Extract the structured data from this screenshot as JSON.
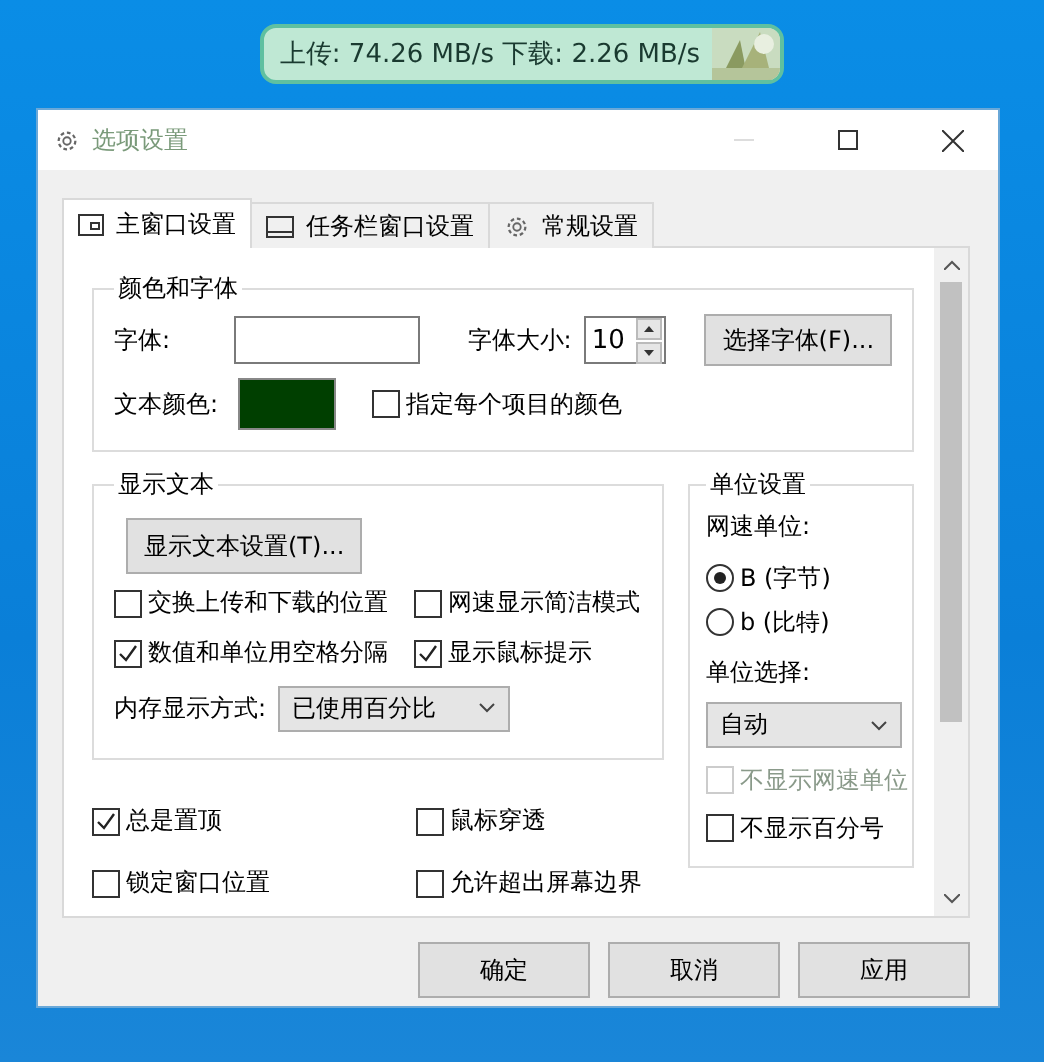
{
  "speed_widget": {
    "text": "上传: 74.26 MB/s 下载: 2.26 MB/s"
  },
  "window": {
    "title": "选项设置"
  },
  "tabs": [
    {
      "label": "主窗口设置",
      "kind": "window",
      "selected": true
    },
    {
      "label": "任务栏窗口设置",
      "kind": "taskbar",
      "selected": false
    },
    {
      "label": "常规设置",
      "kind": "gear",
      "selected": false
    }
  ],
  "color_font": {
    "title": "颜色和字体",
    "font_label": "字体:",
    "font_size_label": "字体大小:",
    "font_size": "10",
    "choose_font_button": "选择字体(F)...",
    "text_color_label": "文本颜色:",
    "text_color_swatch": {
      "color": "#003f00"
    },
    "per_item_color": {
      "label": "指定每个项目的颜色",
      "checked": false
    }
  },
  "display_text": {
    "title": "显示文本",
    "settings_button": "显示文本设置(T)...",
    "checkboxes": [
      {
        "label": "交换上传和下载的位置",
        "checked": false
      },
      {
        "label": "网速显示简洁模式",
        "checked": false
      },
      {
        "label": "数值和单位用空格分隔",
        "checked": true
      },
      {
        "label": "显示鼠标提示",
        "checked": true
      }
    ],
    "memory_label": "内存显示方式:",
    "memory_value": "已使用百分比"
  },
  "unit_settings": {
    "title": "单位设置",
    "speed_unit_label": "网速单位:",
    "radios": [
      {
        "label": "B (字节)",
        "selected": true
      },
      {
        "label": "b (比特)",
        "selected": false
      }
    ],
    "unit_select_label": "单位选择:",
    "unit_value": "自动",
    "checkboxes": [
      {
        "label": "不显示网速单位",
        "checked": false,
        "disabled": true
      },
      {
        "label": "不显示百分号",
        "checked": false,
        "disabled": false
      }
    ]
  },
  "general_checkboxes": [
    {
      "label": "总是置顶",
      "checked": true
    },
    {
      "label": "鼠标穿透",
      "checked": false
    },
    {
      "label": "锁定窗口位置",
      "checked": false
    },
    {
      "label": "允许超出屏幕边界",
      "checked": false
    }
  ],
  "buttons": [
    "确定",
    "取消",
    "应用"
  ]
}
